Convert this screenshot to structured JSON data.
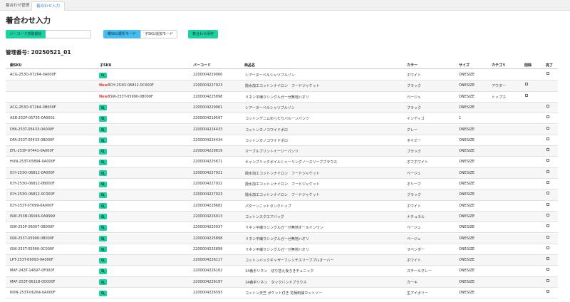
{
  "tabs": [
    {
      "label": "着合わせ管理"
    },
    {
      "label": "着合わせ入力"
    }
  ],
  "page_title": "着合わせ入力",
  "toolbar": {
    "barcode_button": "バーコード読取開始",
    "barcode_input_value": "",
    "mode_parent": "親SKU選択モード",
    "mode_child": "子SKU追加モード",
    "save_button": "着合わせ保存"
  },
  "management_number": "管理番号: 20250521_01",
  "table": {
    "headers": {
      "parent_sku": "親SKU",
      "child_sku": "子SKU",
      "barcode": "バーコード",
      "product_name": "商品名",
      "color": "カラー",
      "size": "サイズ",
      "category": "カテゴリ",
      "delete": "削除",
      "done": "完了"
    },
    "new_label": "New!",
    "rows": [
      {
        "parent": "ACG-253O-07264-0A000F",
        "child": "",
        "barcode": "2200004229060",
        "name": "シアーヌーベルシャツブルゾン",
        "color": "ホワイト",
        "size": "ONESIZE",
        "category": "",
        "delete": false,
        "done": true,
        "icon": true
      },
      {
        "parent": "",
        "child": "ICH-253O-06812-0C000F",
        "barcode": "2200004227923",
        "name": "撥水加工コットンナイロン　フードジャケット",
        "color": "ブラック",
        "size": "ONESIZE",
        "category": "アウター",
        "delete": true,
        "done": false,
        "icon": false
      },
      {
        "parent": "",
        "child": "ISW-253T-05990-0B000F",
        "barcode": "2200004225898",
        "name": "リネン平織りシングルガーゼ無地ハオリ",
        "color": "ベージュ",
        "size": "ONESIZE",
        "category": "トップス",
        "delete": true,
        "done": false,
        "icon": false
      },
      {
        "parent": "ACG-253O-07264-0B000F",
        "child": "",
        "barcode": "2200004229061",
        "name": "シアーヌーベルシャツブルゾン",
        "color": "ブラック",
        "size": "ONESIZE",
        "category": "",
        "delete": false,
        "done": true,
        "icon": true
      },
      {
        "parent": "ASR-252P-05735-0A0001",
        "child": "",
        "barcode": "2200004219597",
        "name": "コットンデニムゆったりバルーンパンツ",
        "color": "インディゴ",
        "size": "1",
        "category": "",
        "delete": false,
        "done": true,
        "icon": true
      },
      {
        "parent": "DFA-253T-05433-0A000F",
        "child": "",
        "barcode": "2200004224433",
        "name": "コットンカノコワイドポロ",
        "color": "グレー",
        "size": "ONESIZE",
        "category": "",
        "delete": false,
        "done": true,
        "icon": true
      },
      {
        "parent": "DFA-253T-05433-0B000F",
        "child": "",
        "barcode": "2200004224434",
        "name": "コットンカノコワイドポロ",
        "color": "ネイビー",
        "size": "ONESIZE",
        "category": "",
        "delete": false,
        "done": true,
        "icon": true
      },
      {
        "parent": "EFL-253P-07441-0A000F",
        "child": "",
        "barcode": "2200004229819",
        "name": "マーブルプリントイージーパンツ",
        "color": "ブラック",
        "size": "ONESIZE",
        "category": "",
        "delete": false,
        "done": true,
        "icon": true
      },
      {
        "parent": "HUN-253T-05894-0A000F",
        "child": "",
        "barcode": "2200004225671",
        "name": "キャンブリックボイルシャーリングノースリーブブラウス",
        "color": "オフホワイト",
        "size": "ONESIZE",
        "category": "",
        "delete": false,
        "done": true,
        "icon": true
      },
      {
        "parent": "ICH-253O-06812-0A000F",
        "child": "",
        "barcode": "2200004227921",
        "name": "撥水加工コットンナイロン　フードジャケット",
        "color": "ベージュ",
        "size": "ONESIZE",
        "category": "",
        "delete": false,
        "done": true,
        "icon": true
      },
      {
        "parent": "ICH-253O-06812-0B000F",
        "child": "",
        "barcode": "2200004227922",
        "name": "撥水加工コットンナイロン　フードジャケット",
        "color": "オリーブ",
        "size": "ONESIZE",
        "category": "",
        "delete": false,
        "done": true,
        "icon": true
      },
      {
        "parent": "ICH-253O-06812-0C000F",
        "child": "",
        "barcode": "2200004227923",
        "name": "撥水加工コットンナイロン　フードジャケット",
        "color": "ブラック",
        "size": "ONESIZE",
        "category": "",
        "delete": false,
        "done": true,
        "icon": true
      },
      {
        "parent": "ICH-253T-07099-0A000F",
        "child": "",
        "barcode": "2200004228682",
        "name": "パターンニットタンクトップ",
        "color": "ホワイト",
        "size": "ONESIZE",
        "category": "",
        "delete": false,
        "done": true,
        "icon": true
      },
      {
        "parent": "ISW-253B-06046-0A9999",
        "child": "",
        "barcode": "2200004226013",
        "name": "コットンスクエアバッグ",
        "color": "ナチュラル",
        "size": "ONESIZE",
        "category": "",
        "delete": false,
        "done": true,
        "icon": true
      },
      {
        "parent": "ISW-253P-06007-0B000F",
        "child": "",
        "barcode": "2200004225937",
        "name": "リネン平織りシングルガーゼ無地オールインワン",
        "color": "ベージュ",
        "size": "ONESIZE",
        "category": "",
        "delete": false,
        "done": true,
        "icon": true
      },
      {
        "parent": "ISW-253T-05990-0B000F",
        "child": "",
        "barcode": "2200004225898",
        "name": "リネン平織りシングルガーゼ無地ハオリ",
        "color": "ベージュ",
        "size": "ONESIZE",
        "category": "",
        "delete": false,
        "done": true,
        "icon": true
      },
      {
        "parent": "ISW-253T-05990-0C000F",
        "child": "",
        "barcode": "2200004225899",
        "name": "リネン平織りシングルガーゼ無地ハオリ",
        "color": "ラベンダー",
        "size": "ONESIZE",
        "category": "",
        "delete": false,
        "done": true,
        "icon": true
      },
      {
        "parent": "LPT-253T-06093-0A000F",
        "child": "",
        "barcode": "2200004226117",
        "name": "コットンバックギャザーフレンチスリーブプルオーバー",
        "color": "ホワイト",
        "size": "ONESIZE",
        "category": "",
        "delete": false,
        "done": true,
        "icon": true
      },
      {
        "parent": "MAF-243T-14697-0F000F",
        "child": "",
        "barcode": "2200004226162",
        "name": "14番手リネン　切り替え後ろきチュニック",
        "color": "スチールグレー",
        "size": "ONESIZE",
        "category": "",
        "delete": false,
        "done": true,
        "icon": true
      },
      {
        "parent": "MAF-253T-06118-0D000F",
        "child": "",
        "barcode": "2200004226197",
        "name": "14番手リネン　タックバンドブラウス",
        "color": "カーキ",
        "size": "ONESIZE",
        "category": "",
        "delete": false,
        "done": true,
        "icon": true
      },
      {
        "parent": "NON-253T-06264-0A000F",
        "child": "",
        "barcode": "2200004226593",
        "name": "コットン天竺 ポケット付き 花柄刺繍カットソー",
        "color": "生アイボリー",
        "size": "ONESIZE",
        "category": "",
        "delete": false,
        "done": true,
        "icon": true
      }
    ]
  }
}
